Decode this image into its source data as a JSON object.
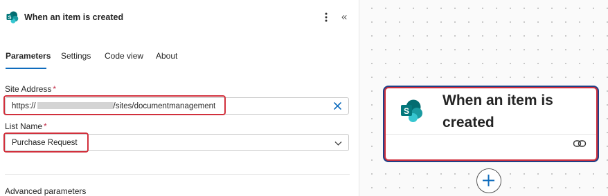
{
  "panel": {
    "title": "When an item is created",
    "tabs": [
      "Parameters",
      "Settings",
      "Code view",
      "About"
    ],
    "active_tab": "Parameters",
    "fields": {
      "site_address": {
        "label": "Site Address",
        "required_mark": "*",
        "value_prefix": "https://",
        "value_suffix": "/sites/documentmanagement"
      },
      "list_name": {
        "label": "List Name",
        "required_mark": "*",
        "value": "Purchase Request"
      }
    },
    "advanced_label": "Advanced parameters"
  },
  "canvas": {
    "card_title": "When an item is created"
  },
  "icons": {
    "connector": "sharepoint-icon",
    "more": "more-vertical-icon",
    "collapse": "collapse-left-icon",
    "clear": "close-icon",
    "dropdown": "chevron-down-icon",
    "link": "link-icon",
    "add": "plus-icon"
  },
  "colors": {
    "accent": "#0f6cbd",
    "highlight": "#d1303c",
    "selection": "#1f3f86",
    "sharepoint_primary": "#036c70",
    "sharepoint_light": "#37c6d0"
  }
}
